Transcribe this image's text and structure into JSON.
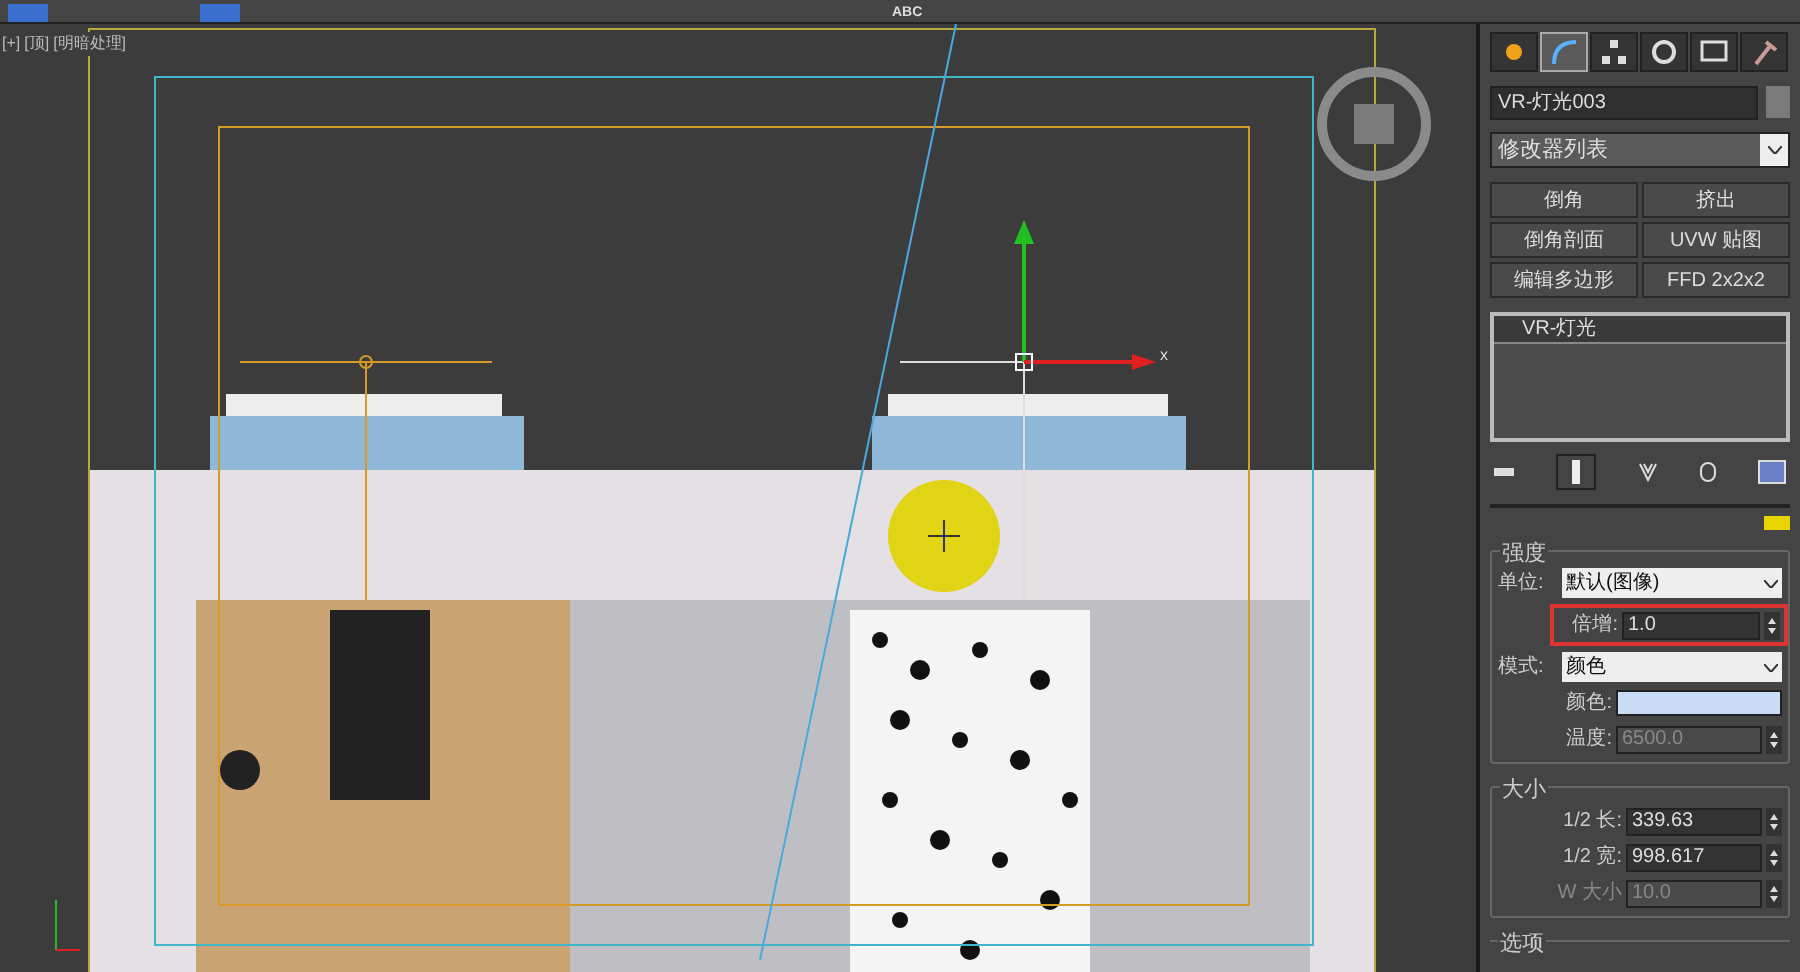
{
  "toolbar": {
    "text_label": "ABC"
  },
  "viewport": {
    "labels": [
      "[+]",
      "[顶]",
      "[明暗处理]"
    ],
    "axis_label": "x"
  },
  "command_panel": {
    "tabs": [
      {
        "kind": "create",
        "selected": false
      },
      {
        "kind": "modify",
        "selected": true
      },
      {
        "kind": "hierarchy",
        "selected": false
      },
      {
        "kind": "motion",
        "selected": false
      },
      {
        "kind": "display",
        "selected": false
      },
      {
        "kind": "utilities",
        "selected": false
      }
    ],
    "object_name": "VR-灯光003",
    "modifier_list": "修改器列表",
    "modifier_buttons": [
      "倒角",
      "挤出",
      "倒角剖面",
      "UVW 贴图",
      "编辑多边形",
      "FFD 2x2x2"
    ],
    "stack": [
      {
        "label": "VR-灯光",
        "selected": true
      }
    ],
    "intensity": {
      "title": "强度",
      "unit_label": "单位:",
      "unit_value": "默认(图像)",
      "multiplier_label": "倍增:",
      "multiplier_value": "1.0",
      "mode_label": "模式:",
      "mode_value": "颜色",
      "color_label": "颜色:",
      "color": "#c8dcf6",
      "temperature_label": "温度:",
      "temperature_value": "6500.0",
      "temperature_disabled": true
    },
    "size": {
      "title": "大小",
      "fields": [
        {
          "label": "1/2 长:",
          "value": "339.63",
          "disabled": false
        },
        {
          "label": "1/2 宽:",
          "value": "998.617",
          "disabled": false
        },
        {
          "label": "W 大小",
          "value": "10.0",
          "disabled": true
        }
      ]
    },
    "options": {
      "title": "选项"
    }
  }
}
